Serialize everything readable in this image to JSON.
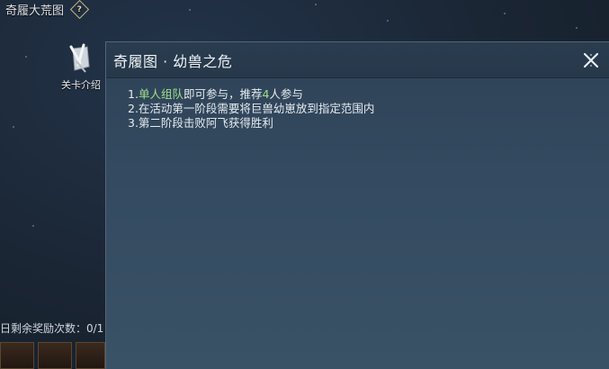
{
  "background": {
    "title": "奇履大荒图",
    "help_glyph": "?",
    "intro_button_label": "关卡介绍",
    "reward_count_label": "日剩余奖励次数：0/1",
    "intro_icon": "scroll-feather-icon"
  },
  "dialog": {
    "title": "奇履图 · 幼兽之危",
    "close_icon": "close-icon",
    "rules": {
      "line1_prefix": "1.",
      "line1_highlight1": "单人组队",
      "line1_middle": "即可参与，推荐",
      "line1_highlight2": "4",
      "line1_suffix": "人参与",
      "line2": "2.在活动第一阶段需要将巨兽幼崽放到指定范围内",
      "line3": "3.第二阶段击败阿飞获得胜利"
    }
  },
  "colors": {
    "highlight": "#9fe08a",
    "dialog_bg": "#334a60",
    "header_bg": "#26384a"
  }
}
